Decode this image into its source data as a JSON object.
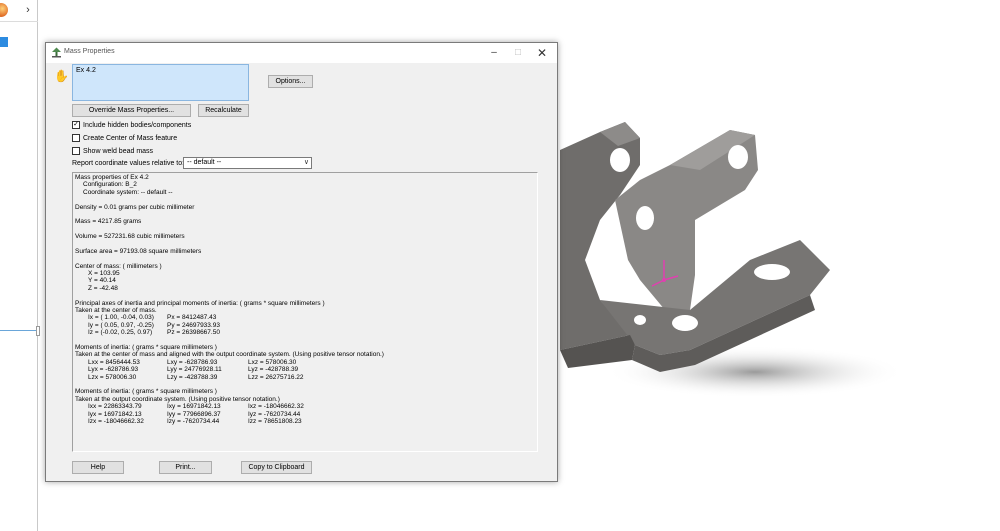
{
  "window": {
    "title": "Mass Properties"
  },
  "selection": {
    "items": [
      "Ex 4.2"
    ]
  },
  "buttons": {
    "options": "Options...",
    "override": "Override Mass Properties...",
    "recalculate": "Recalculate",
    "help": "Help",
    "print": "Print...",
    "copy": "Copy to Clipboard"
  },
  "checkboxes": {
    "include_hidden": {
      "label": "Include hidden bodies/components",
      "checked": true
    },
    "create_com": {
      "label": "Create Center of Mass feature",
      "checked": false
    },
    "show_weld": {
      "label": "Show weld bead mass",
      "checked": false
    }
  },
  "report": {
    "label": "Report coordinate values relative to:",
    "value": "-- default --"
  },
  "results": {
    "header": "Mass properties of Ex 4.2",
    "configuration": "Configuration: B_2",
    "coord_system": "Coordinate system: -- default --",
    "density": "Density = 0.01 grams per cubic millimeter",
    "mass": "Mass = 4217.85 grams",
    "volume": "Volume = 527231.68 cubic millimeters",
    "surface_area": "Surface area = 97193.08  square millimeters",
    "com_title": "Center of mass: ( millimeters )",
    "com_x": "X = 103.95",
    "com_y": "Y = 40.14",
    "com_z": "Z = -42.48",
    "principal_title": "Principal axes of inertia and principal moments of inertia: ( grams *  square millimeters )",
    "principal_sub": "Taken at the center of mass.",
    "principal_rows": [
      {
        "axis": "Ix = ( 1.00, -0.04,  0.03)",
        "moment": "Px = 8412487.43"
      },
      {
        "axis": "Iy = ( 0.05,  0.97, -0.25)",
        "moment": "Py = 24697933.93"
      },
      {
        "axis": "Iz = (-0.02,  0.25,  0.97)",
        "moment": "Pz = 26398667.50"
      }
    ],
    "moments_com_title": "Moments of inertia: ( grams *  square millimeters )",
    "moments_com_sub": "Taken at the center of mass and aligned with the output coordinate system. (Using positive tensor notation.)",
    "moments_com_rows": [
      [
        "Lxx = 8456444.53",
        "Lxy = -628786.93",
        "Lxz = 578006.30"
      ],
      [
        "Lyx = -628786.93",
        "Lyy = 24776928.11",
        "Lyz = -428788.39"
      ],
      [
        "Lzx = 578006.30",
        "Lzy = -428788.39",
        "Lzz = 26275716.22"
      ]
    ],
    "moments_out_title": "Moments of inertia: ( grams *  square millimeters )",
    "moments_out_sub": "Taken at the output coordinate system. (Using positive tensor notation.)",
    "moments_out_rows": [
      [
        "Ixx = 22863343.79",
        "Ixy = 16971842.13",
        "Ixz = -18046662.32"
      ],
      [
        "Iyx = 16971842.13",
        "Iyy = 77966896.37",
        "Iyz = -7620734.44"
      ],
      [
        "Izx = -18046662.32",
        "Izy = -7620734.44",
        "Izz = 78651808.23"
      ]
    ]
  }
}
